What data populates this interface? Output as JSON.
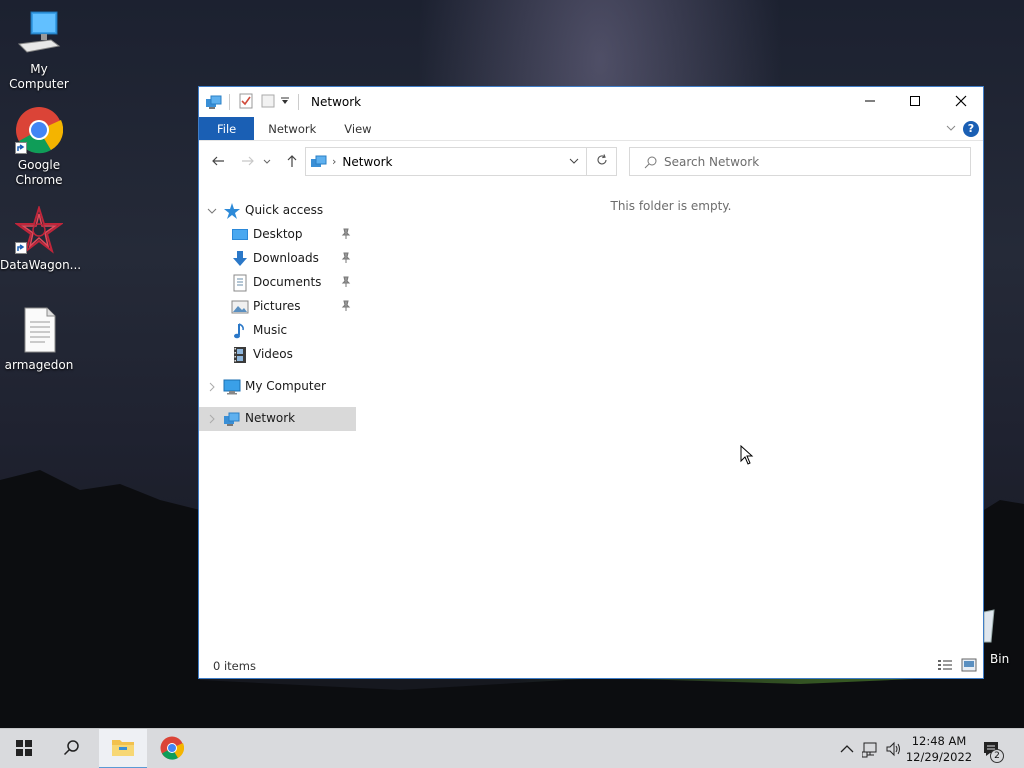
{
  "desktop": {
    "icons": [
      {
        "label": "My Computer"
      },
      {
        "label": "Google Chrome"
      },
      {
        "label": "DataWagon..."
      },
      {
        "label": "armagedon"
      }
    ],
    "recycle_partial_label": "Bin"
  },
  "window": {
    "title": "Network",
    "ribbon": {
      "tabs": [
        {
          "label": "File"
        },
        {
          "label": "Network"
        },
        {
          "label": "View"
        }
      ],
      "help_label": "?"
    },
    "address": {
      "path": "Network"
    },
    "search": {
      "placeholder": "Search Network"
    },
    "nav_pane": {
      "quick_access": "Quick access",
      "quick_items": [
        {
          "label": "Desktop",
          "pinned": true
        },
        {
          "label": "Downloads",
          "pinned": true
        },
        {
          "label": "Documents",
          "pinned": true
        },
        {
          "label": "Pictures",
          "pinned": true
        },
        {
          "label": "Music",
          "pinned": false
        },
        {
          "label": "Videos",
          "pinned": false
        }
      ],
      "my_computer": "My Computer",
      "network": "Network"
    },
    "content": {
      "empty_message": "This folder is empty."
    },
    "status": {
      "item_count": "0 items"
    }
  },
  "taskbar": {
    "time": "12:48 AM",
    "date": "12/29/2022",
    "notification_count": "2"
  },
  "colors": {
    "accent": "#1a5fb4",
    "selection": "#d9d9d9",
    "taskbar": "#d9dadd"
  }
}
